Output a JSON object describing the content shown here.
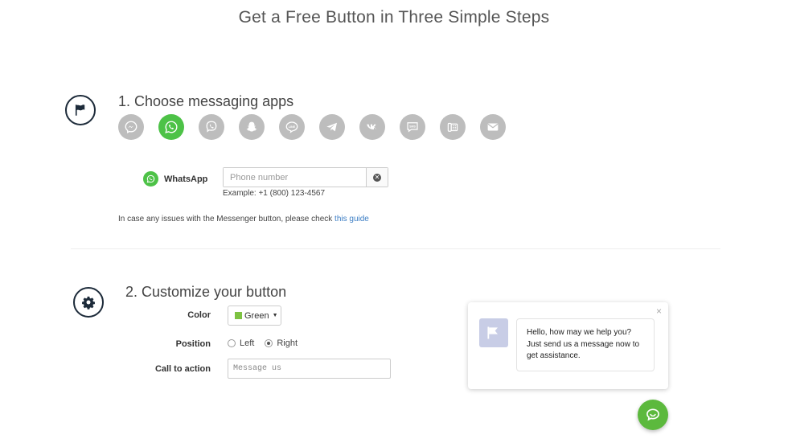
{
  "page": {
    "title": "Get a Free Button in Three Simple Steps"
  },
  "step1": {
    "heading": "1. Choose messaging apps",
    "icon": "flag-icon",
    "apps": [
      {
        "name": "messenger",
        "icon": "messenger-icon",
        "active": false
      },
      {
        "name": "whatsapp",
        "icon": "whatsapp-icon",
        "active": true
      },
      {
        "name": "viber",
        "icon": "viber-icon",
        "active": false
      },
      {
        "name": "snapchat",
        "icon": "snapchat-icon",
        "active": false
      },
      {
        "name": "line",
        "icon": "line-icon",
        "active": false,
        "text": "LINE"
      },
      {
        "name": "telegram",
        "icon": "telegram-icon",
        "active": false
      },
      {
        "name": "vk",
        "icon": "vk-icon",
        "active": false
      },
      {
        "name": "sms",
        "icon": "sms-icon",
        "active": false,
        "text": "SMS"
      },
      {
        "name": "call",
        "icon": "phone-call-icon",
        "active": false
      },
      {
        "name": "email",
        "icon": "email-icon",
        "active": false
      }
    ],
    "selected_app_label": "WhatsApp",
    "phone_placeholder": "Phone number",
    "phone_value": "",
    "phone_example": "Example: +1 (800) 123-4567",
    "help_text": "In case any issues with the Messenger button, please check ",
    "help_link": "this guide"
  },
  "step2": {
    "heading": "2. Customize your button",
    "icon": "gear-icon",
    "color_label": "Color",
    "color_value": "Green",
    "color_hex": "#7dc242",
    "position_label": "Position",
    "position_options": [
      "Left",
      "Right"
    ],
    "position_selected": "Right",
    "cta_label": "Call to action",
    "cta_placeholder": "Message us",
    "cta_value": ""
  },
  "widget": {
    "close": "×",
    "message": "Hello, how may we help you? Just send us a message now to get assistance.",
    "avatar_icon": "flag-icon",
    "fab_icon": "chat-bubbles-icon",
    "fab_color": "#5cb93d"
  },
  "colors": {
    "active_app": "#4dc247",
    "inactive_app": "#bdbdbd",
    "link": "#3b7dc4",
    "step_icon_border": "#1d2b3a"
  }
}
